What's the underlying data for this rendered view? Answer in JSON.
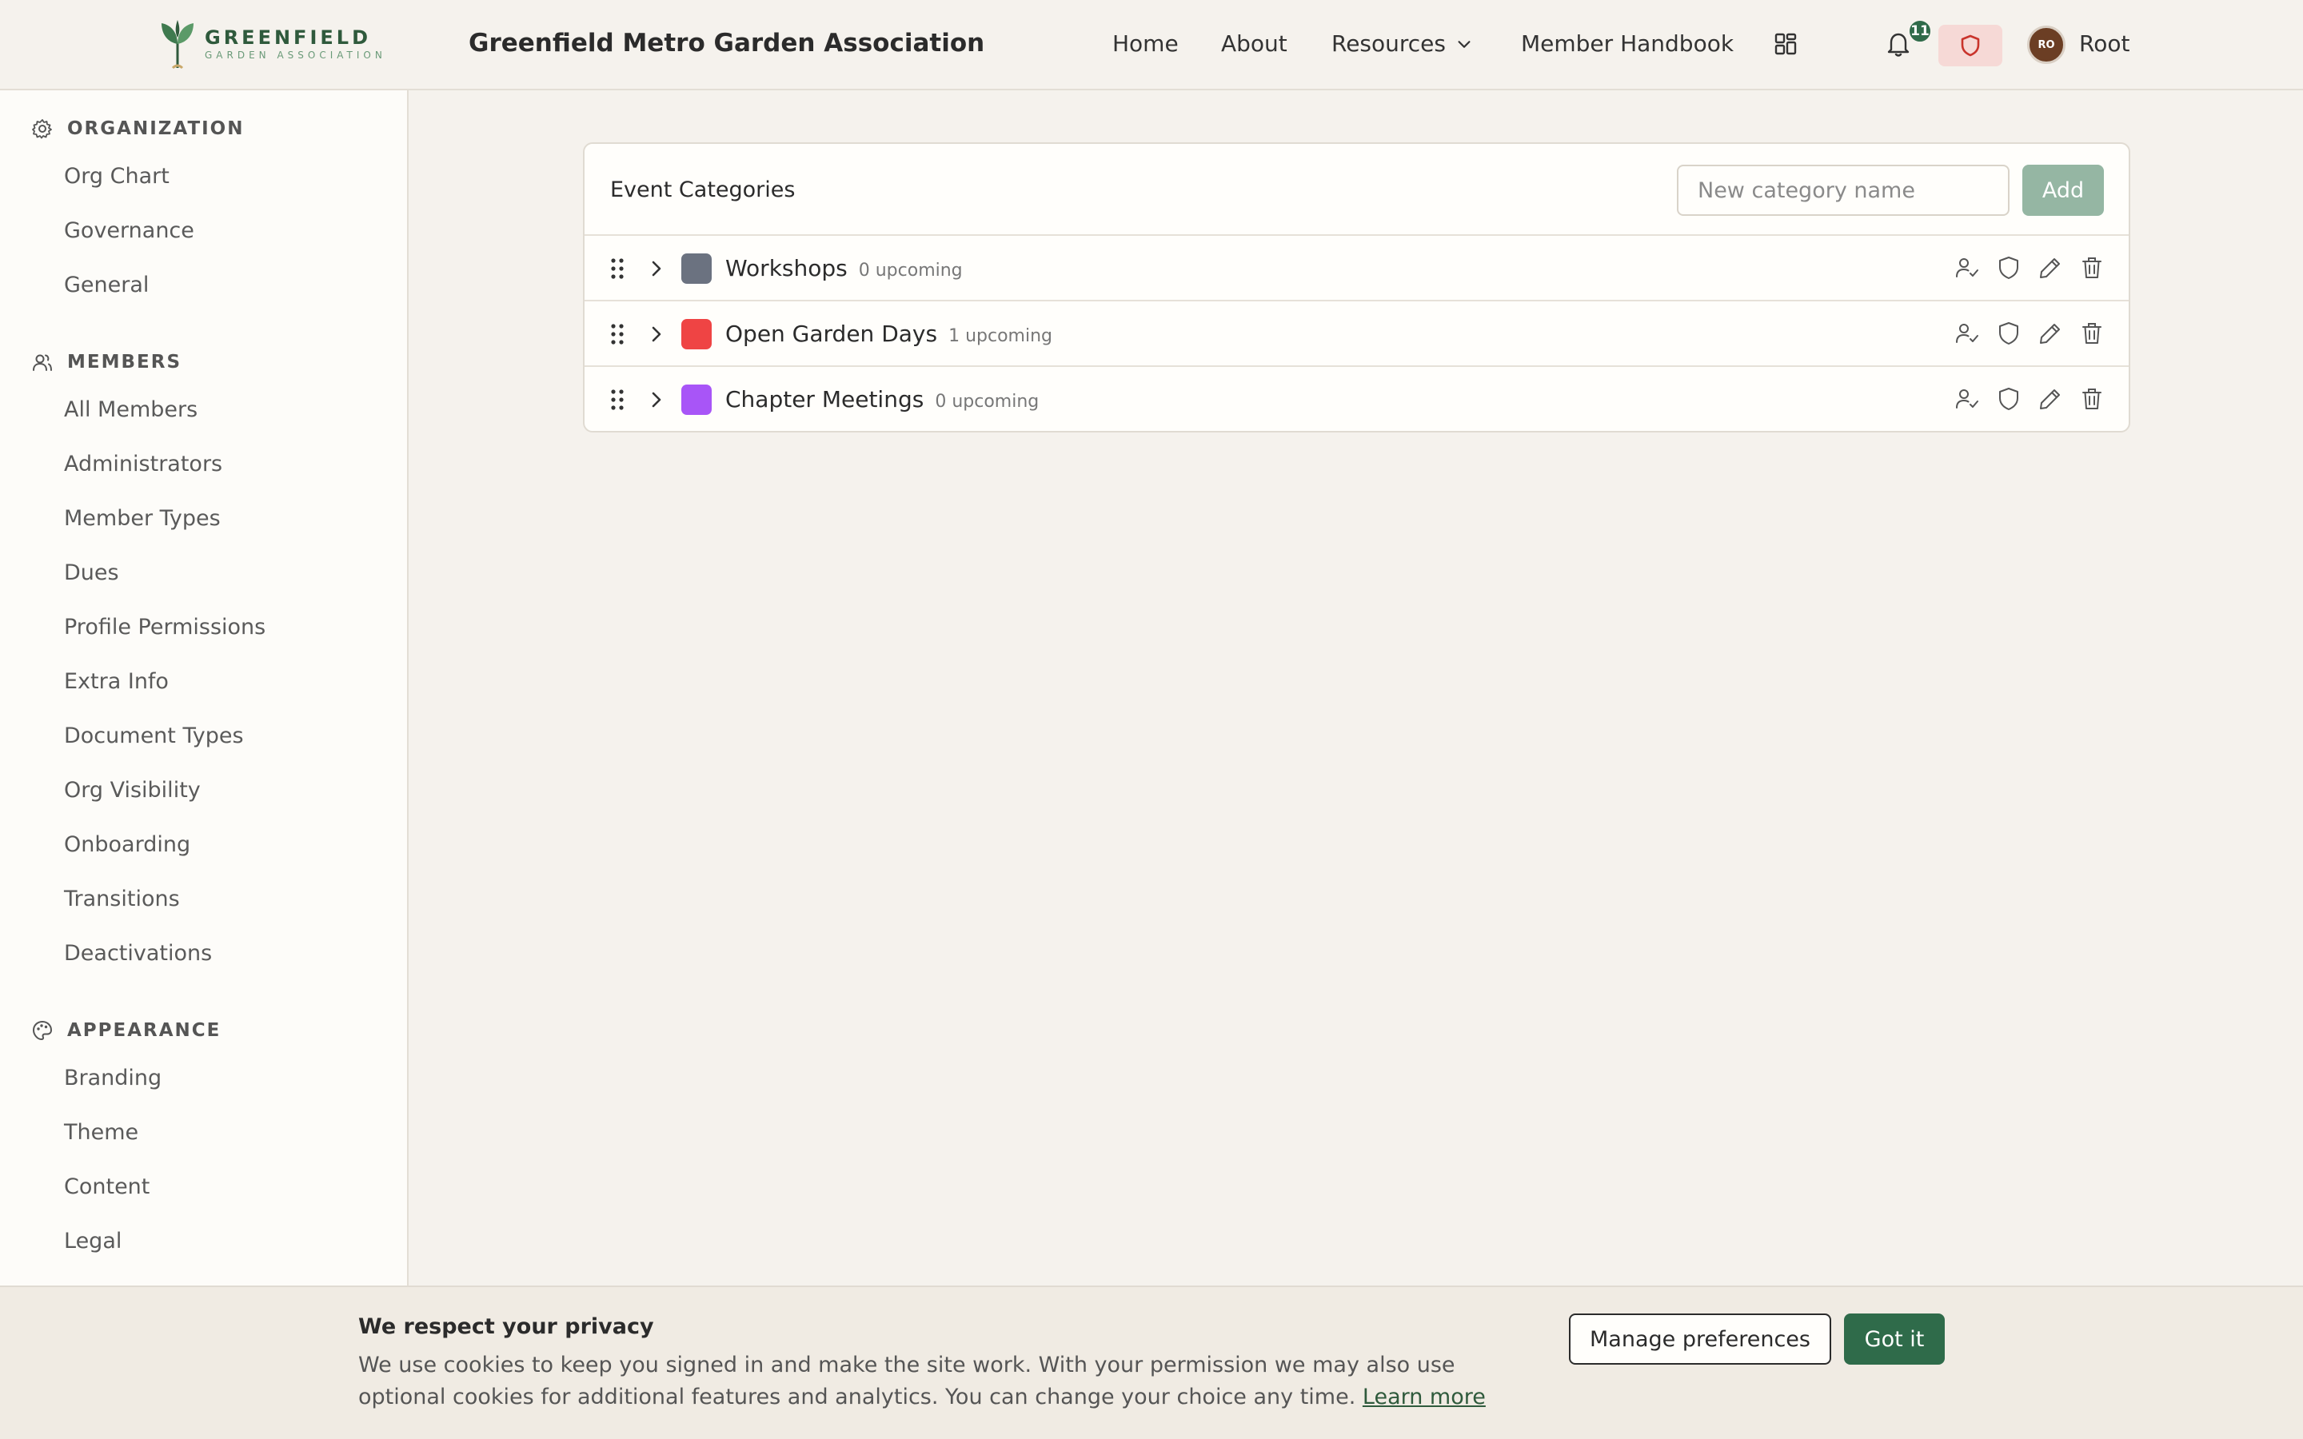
{
  "header": {
    "logo_main": "GREENFIELD",
    "logo_sub": "GARDEN ASSOCIATION",
    "title": "Greenfield Metro Garden Association",
    "nav": {
      "home": "Home",
      "about": "About",
      "resources": "Resources",
      "handbook": "Member Handbook"
    },
    "notification_count": "11",
    "avatar_initials": "RO",
    "user_name": "Root",
    "icons": [
      "seedling-logo-icon",
      "chevron-down-icon",
      "apps-grid-icon",
      "bell-icon",
      "shield-icon"
    ]
  },
  "sidebar": {
    "organization": {
      "label": "ORGANIZATION",
      "icon": "gear-icon",
      "items": [
        "Org Chart",
        "Governance",
        "General"
      ]
    },
    "members": {
      "label": "MEMBERS",
      "icon": "users-icon",
      "items": [
        "All Members",
        "Administrators",
        "Member Types",
        "Dues",
        "Profile Permissions",
        "Extra Info",
        "Document Types",
        "Org Visibility",
        "Onboarding",
        "Transitions",
        "Deactivations"
      ]
    },
    "appearance": {
      "label": "APPEARANCE",
      "icon": "palette-icon",
      "items": [
        "Branding",
        "Theme",
        "Content",
        "Legal"
      ]
    }
  },
  "categories": {
    "title": "Event Categories",
    "input_placeholder": "New category name",
    "add_label": "Add",
    "rows": [
      {
        "name": "Workshops",
        "meta": "0 upcoming",
        "color": "#6b7280"
      },
      {
        "name": "Open Garden Days",
        "meta": "1 upcoming",
        "color": "#ef4444"
      },
      {
        "name": "Chapter Meetings",
        "meta": "0 upcoming",
        "color": "#a855f7"
      }
    ],
    "row_icons": [
      "drag-handle-icon",
      "chevron-right-icon",
      "user-check-icon",
      "shield-icon",
      "pencil-icon",
      "trash-icon"
    ]
  },
  "cookie": {
    "title": "We respect your privacy",
    "body": "We use cookies to keep you signed in and make the site work. With your permission we may also use optional cookies for additional features and analytics. You can change your choice any time.",
    "learn_more": "Learn more",
    "manage_label": "Manage preferences",
    "accept_label": "Got it"
  },
  "colors": {
    "brand": "#2f6b4a",
    "background": "#f5f2ed",
    "add_button": "#95b6a3"
  }
}
